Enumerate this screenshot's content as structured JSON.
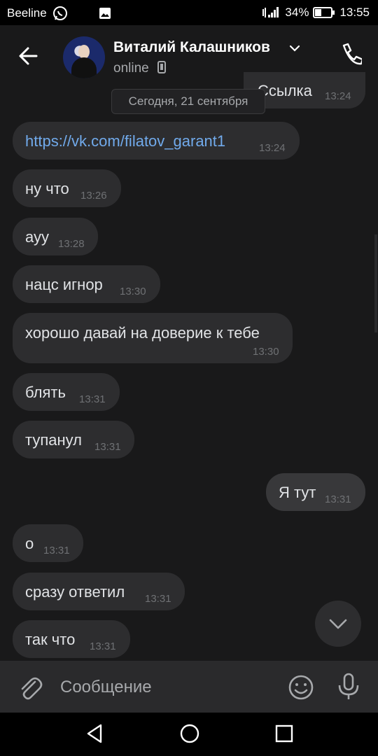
{
  "status_bar": {
    "carrier": "Beeline",
    "battery": "34%",
    "time": "13:55"
  },
  "header": {
    "contact_name": "Виталий Калашников",
    "presence": "online"
  },
  "date_separator": "Сегодня, 21 сентября",
  "partial_top_message": {
    "text": "Ссылка",
    "time": "13:24"
  },
  "messages": [
    {
      "text": "https://vk.com/filatov_garant1",
      "time": "13:24",
      "direction": "in",
      "is_link": true
    },
    {
      "text": "ну что",
      "time": "13:26",
      "direction": "in"
    },
    {
      "text": "ауу",
      "time": "13:28",
      "direction": "in"
    },
    {
      "text": "нацс игнор",
      "time": "13:30",
      "direction": "in"
    },
    {
      "text": "хорошо давай на доверие к тебе",
      "time": "13:30",
      "direction": "in"
    },
    {
      "text": "блять",
      "time": "13:31",
      "direction": "in"
    },
    {
      "text": "тупанул",
      "time": "13:31",
      "direction": "in"
    },
    {
      "text": "Я тут",
      "time": "13:31",
      "direction": "out"
    },
    {
      "text": "о",
      "time": "13:31",
      "direction": "in"
    },
    {
      "text": "сразу ответил",
      "time": "13:31",
      "direction": "in"
    },
    {
      "text": "так что",
      "time": "13:31",
      "direction": "in"
    }
  ],
  "composer": {
    "placeholder": "Сообщение"
  },
  "colors": {
    "background": "#19191a",
    "bubble": "#2d2d2f",
    "link": "#71aaeb",
    "accent_icon": "#a7a9ac"
  }
}
